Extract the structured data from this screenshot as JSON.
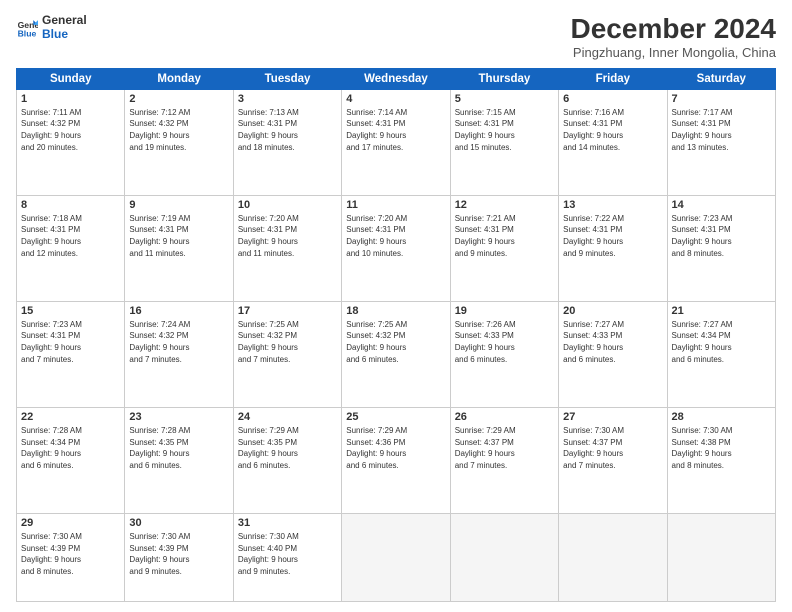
{
  "logo": {
    "line1": "General",
    "line2": "Blue"
  },
  "title": "December 2024",
  "subtitle": "Pingzhuang, Inner Mongolia, China",
  "days_header": [
    "Sunday",
    "Monday",
    "Tuesday",
    "Wednesday",
    "Thursday",
    "Friday",
    "Saturday"
  ],
  "weeks": [
    [
      {
        "day": "1",
        "info": "Sunrise: 7:11 AM\nSunset: 4:32 PM\nDaylight: 9 hours\nand 20 minutes."
      },
      {
        "day": "2",
        "info": "Sunrise: 7:12 AM\nSunset: 4:32 PM\nDaylight: 9 hours\nand 19 minutes."
      },
      {
        "day": "3",
        "info": "Sunrise: 7:13 AM\nSunset: 4:31 PM\nDaylight: 9 hours\nand 18 minutes."
      },
      {
        "day": "4",
        "info": "Sunrise: 7:14 AM\nSunset: 4:31 PM\nDaylight: 9 hours\nand 17 minutes."
      },
      {
        "day": "5",
        "info": "Sunrise: 7:15 AM\nSunset: 4:31 PM\nDaylight: 9 hours\nand 15 minutes."
      },
      {
        "day": "6",
        "info": "Sunrise: 7:16 AM\nSunset: 4:31 PM\nDaylight: 9 hours\nand 14 minutes."
      },
      {
        "day": "7",
        "info": "Sunrise: 7:17 AM\nSunset: 4:31 PM\nDaylight: 9 hours\nand 13 minutes."
      }
    ],
    [
      {
        "day": "8",
        "info": "Sunrise: 7:18 AM\nSunset: 4:31 PM\nDaylight: 9 hours\nand 12 minutes."
      },
      {
        "day": "9",
        "info": "Sunrise: 7:19 AM\nSunset: 4:31 PM\nDaylight: 9 hours\nand 11 minutes."
      },
      {
        "day": "10",
        "info": "Sunrise: 7:20 AM\nSunset: 4:31 PM\nDaylight: 9 hours\nand 11 minutes."
      },
      {
        "day": "11",
        "info": "Sunrise: 7:20 AM\nSunset: 4:31 PM\nDaylight: 9 hours\nand 10 minutes."
      },
      {
        "day": "12",
        "info": "Sunrise: 7:21 AM\nSunset: 4:31 PM\nDaylight: 9 hours\nand 9 minutes."
      },
      {
        "day": "13",
        "info": "Sunrise: 7:22 AM\nSunset: 4:31 PM\nDaylight: 9 hours\nand 9 minutes."
      },
      {
        "day": "14",
        "info": "Sunrise: 7:23 AM\nSunset: 4:31 PM\nDaylight: 9 hours\nand 8 minutes."
      }
    ],
    [
      {
        "day": "15",
        "info": "Sunrise: 7:23 AM\nSunset: 4:31 PM\nDaylight: 9 hours\nand 7 minutes."
      },
      {
        "day": "16",
        "info": "Sunrise: 7:24 AM\nSunset: 4:32 PM\nDaylight: 9 hours\nand 7 minutes."
      },
      {
        "day": "17",
        "info": "Sunrise: 7:25 AM\nSunset: 4:32 PM\nDaylight: 9 hours\nand 7 minutes."
      },
      {
        "day": "18",
        "info": "Sunrise: 7:25 AM\nSunset: 4:32 PM\nDaylight: 9 hours\nand 6 minutes."
      },
      {
        "day": "19",
        "info": "Sunrise: 7:26 AM\nSunset: 4:33 PM\nDaylight: 9 hours\nand 6 minutes."
      },
      {
        "day": "20",
        "info": "Sunrise: 7:27 AM\nSunset: 4:33 PM\nDaylight: 9 hours\nand 6 minutes."
      },
      {
        "day": "21",
        "info": "Sunrise: 7:27 AM\nSunset: 4:34 PM\nDaylight: 9 hours\nand 6 minutes."
      }
    ],
    [
      {
        "day": "22",
        "info": "Sunrise: 7:28 AM\nSunset: 4:34 PM\nDaylight: 9 hours\nand 6 minutes."
      },
      {
        "day": "23",
        "info": "Sunrise: 7:28 AM\nSunset: 4:35 PM\nDaylight: 9 hours\nand 6 minutes."
      },
      {
        "day": "24",
        "info": "Sunrise: 7:29 AM\nSunset: 4:35 PM\nDaylight: 9 hours\nand 6 minutes."
      },
      {
        "day": "25",
        "info": "Sunrise: 7:29 AM\nSunset: 4:36 PM\nDaylight: 9 hours\nand 6 minutes."
      },
      {
        "day": "26",
        "info": "Sunrise: 7:29 AM\nSunset: 4:37 PM\nDaylight: 9 hours\nand 7 minutes."
      },
      {
        "day": "27",
        "info": "Sunrise: 7:30 AM\nSunset: 4:37 PM\nDaylight: 9 hours\nand 7 minutes."
      },
      {
        "day": "28",
        "info": "Sunrise: 7:30 AM\nSunset: 4:38 PM\nDaylight: 9 hours\nand 8 minutes."
      }
    ],
    [
      {
        "day": "29",
        "info": "Sunrise: 7:30 AM\nSunset: 4:39 PM\nDaylight: 9 hours\nand 8 minutes."
      },
      {
        "day": "30",
        "info": "Sunrise: 7:30 AM\nSunset: 4:39 PM\nDaylight: 9 hours\nand 9 minutes."
      },
      {
        "day": "31",
        "info": "Sunrise: 7:30 AM\nSunset: 4:40 PM\nDaylight: 9 hours\nand 9 minutes."
      },
      {
        "day": "",
        "info": ""
      },
      {
        "day": "",
        "info": ""
      },
      {
        "day": "",
        "info": ""
      },
      {
        "day": "",
        "info": ""
      }
    ]
  ]
}
